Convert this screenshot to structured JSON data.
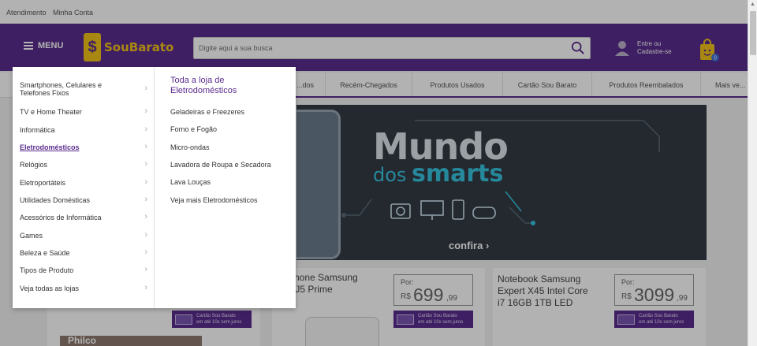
{
  "topbar": {
    "links": [
      "Atendimento",
      "Minha Conta"
    ]
  },
  "header": {
    "menu_label": "MENU",
    "logo_mark": "$",
    "logo_text": "SouBarato",
    "search_placeholder": "Digite aqui a sua busca",
    "account_line1": "Entre ou",
    "account_line2": "Cadastre-se",
    "cart_count": "0"
  },
  "nav": {
    "items": [
      "...dos",
      "Recém-Chegados",
      "Produtos Usados",
      "Cartão Sou Barato",
      "Produtos Reembalados",
      "Mais ve..."
    ]
  },
  "banner": {
    "title": "Mundo",
    "sub_dos": "dos",
    "sub_smarts": "smarts",
    "cta": "confira ›"
  },
  "products": [
    {
      "name_line1": "...rtphone Samsung",
      "name_line2": "...xy J5 Prime",
      "price_prefix": "Por:",
      "currency": "R$",
      "price": "699",
      "cents": ",99",
      "promo_line1": "Cartão Sou Barato",
      "promo_line2": "em até 10x sem juros"
    },
    {
      "name_line1": "Notebook Samsung",
      "name_line2": "Expert X45 Intel Core",
      "name_line3": "i7 16GB 1TB LED",
      "price_prefix": "Por:",
      "currency": "R$",
      "price": "3099",
      "cents": ",99",
      "promo_line1": "Cartão Sou Barato",
      "promo_line2": "em até 10x sem juros"
    }
  ],
  "left_promo": {
    "promo_line1": "Cartão Sou Barato",
    "promo_line2": "em até 10x sem juros",
    "bottom_label": "Philco"
  },
  "dropdown": {
    "categories": [
      {
        "label": "Smartphones, Celulares e Telefones Fixos"
      },
      {
        "label": "TV e Home Theater"
      },
      {
        "label": "Informática"
      },
      {
        "label": "Eletrodomésticos",
        "active": true
      },
      {
        "label": "Relógios"
      },
      {
        "label": "Eletroportáteis"
      },
      {
        "label": "Utilidades Domésticas"
      },
      {
        "label": "Acessórios de Informática"
      },
      {
        "label": "Games"
      },
      {
        "label": "Beleza e Saúde"
      },
      {
        "label": "Tipos de Produto"
      },
      {
        "label": "Veja todas as lojas"
      }
    ],
    "chevron": "›",
    "sub_title": "Toda a loja de Eletrodomésticos",
    "sub_items": [
      "Geladeiras e Freezeres",
      "Forno e Fogão",
      "Micro-ondas",
      "Lavadora de Roupa e Secadora",
      "Lava Louças",
      "Veja mais Eletrodomésticos"
    ]
  },
  "colors": {
    "brand_purple": "#5b2d8e",
    "brand_yellow": "#f3c31a",
    "banner_bg": "#343c46",
    "banner_accent": "#37c3df"
  }
}
